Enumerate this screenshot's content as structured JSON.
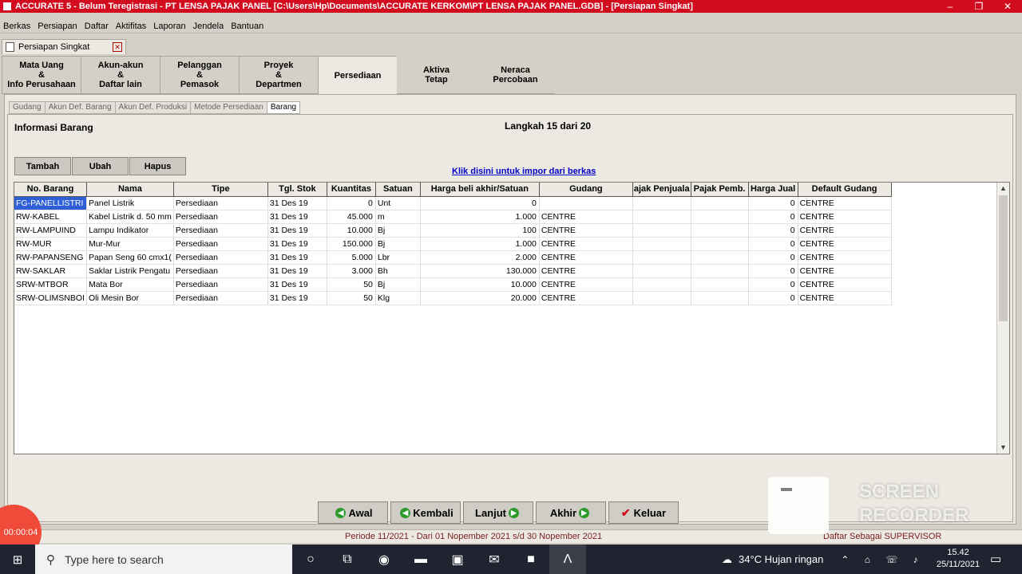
{
  "window": {
    "title": "ACCURATE 5  -  Belum Teregistrasi  -  PT LENSA PAJAK PANEL   [C:\\Users\\Hp\\Documents\\ACCURATE KERKOM\\PT LENSA PAJAK PANEL.GDB] - [Persiapan Singkat]",
    "minimize": "–",
    "restore": "❐",
    "close": "✕"
  },
  "menu": [
    "Berkas",
    "Persiapan",
    "Daftar",
    "Aktifitas",
    "Laporan",
    "Jendela",
    "Bantuan"
  ],
  "doc_tab": {
    "label": "Persiapan Singkat",
    "close": "✕"
  },
  "step_tabs": [
    [
      "Mata Uang",
      "&",
      "Info Perusahaan"
    ],
    [
      "Akun-akun",
      "&",
      "Daftar lain"
    ],
    [
      "Pelanggan",
      "&",
      "Pemasok"
    ],
    [
      "Proyek",
      "&",
      "Departmen"
    ],
    [
      "Persediaan"
    ],
    [
      "Aktiva",
      "Tetap"
    ],
    [
      "Neraca",
      "Percobaan"
    ]
  ],
  "sub_tabs": [
    "Gudang",
    "Akun Def. Barang",
    "Akun Def. Produksi",
    "Metode Persediaan",
    "Barang"
  ],
  "content": {
    "title": "Informasi Barang",
    "step": "Langkah 15 dari 20",
    "buttons": {
      "add": "Tambah",
      "edit": "Ubah",
      "delete": "Hapus"
    },
    "import_link": "Klik disini untuk impor dari berkas"
  },
  "table": {
    "headers": [
      "No. Barang",
      "Nama",
      "Tipe",
      "Tgl. Stok",
      "Kuantitas",
      "Satuan",
      "Harga beli akhir/Satuan",
      "Gudang",
      "ajak Penjuala",
      "Pajak Pemb.",
      "Harga Jual",
      "Default Gudang"
    ],
    "rows": [
      [
        "FG-PANELLISTRI",
        "Panel Listrik",
        "Persediaan",
        "31 Des 19",
        "0",
        "Unt",
        "0",
        "",
        "",
        "",
        "0",
        "CENTRE"
      ],
      [
        "RW-KABEL",
        "Kabel Listrik d. 50 mm",
        "Persediaan",
        "31 Des 19",
        "45.000",
        "m",
        "1.000",
        "CENTRE",
        "",
        "",
        "0",
        "CENTRE"
      ],
      [
        "RW-LAMPUIND",
        "Lampu Indikator",
        "Persediaan",
        "31 Des 19",
        "10.000",
        "Bj",
        "100",
        "CENTRE",
        "",
        "",
        "0",
        "CENTRE"
      ],
      [
        "RW-MUR",
        "Mur-Mur",
        "Persediaan",
        "31 Des 19",
        "150.000",
        "Bj",
        "1.000",
        "CENTRE",
        "",
        "",
        "0",
        "CENTRE"
      ],
      [
        "RW-PAPANSENG",
        "Papan Seng 60 cmx1(",
        "Persediaan",
        "31 Des 19",
        "5.000",
        "Lbr",
        "2.000",
        "CENTRE",
        "",
        "",
        "0",
        "CENTRE"
      ],
      [
        "RW-SAKLAR",
        "Saklar Listrik Pengatu",
        "Persediaan",
        "31 Des 19",
        "3.000",
        "Bh",
        "130.000",
        "CENTRE",
        "",
        "",
        "0",
        "CENTRE"
      ],
      [
        "SRW-MTBOR",
        "Mata Bor",
        "Persediaan",
        "31 Des 19",
        "50",
        "Bj",
        "10.000",
        "CENTRE",
        "",
        "",
        "0",
        "CENTRE"
      ],
      [
        "SRW-OLIMSNBOI",
        "Oli Mesin Bor",
        "Persediaan",
        "31 Des 19",
        "50",
        "Klg",
        "20.000",
        "CENTRE",
        "",
        "",
        "0",
        "CENTRE"
      ]
    ]
  },
  "nav": {
    "first": "Awal",
    "back": "Kembali",
    "next": "Lanjut",
    "last": "Akhir",
    "exit": "Keluar"
  },
  "status": {
    "period": "Periode 11/2021 - Dari 01 Nopember 2021 s/d 30 Nopember 2021",
    "user": "Daftar Sebagai SUPERVISOR"
  },
  "recorder": {
    "timer": "00:00:04",
    "watermark_line1": "SCREEN",
    "watermark_line2": "RECORDER"
  },
  "taskbar": {
    "search_placeholder": "Type here to search",
    "weather": "34°C  Hujan ringan",
    "time": "15.42",
    "date": "25/11/2021"
  },
  "colors": {
    "title_bar": "#d30b1f",
    "selection": "#2f5fd6",
    "link": "#0000c8",
    "nav_green": "#2e9a2e"
  }
}
